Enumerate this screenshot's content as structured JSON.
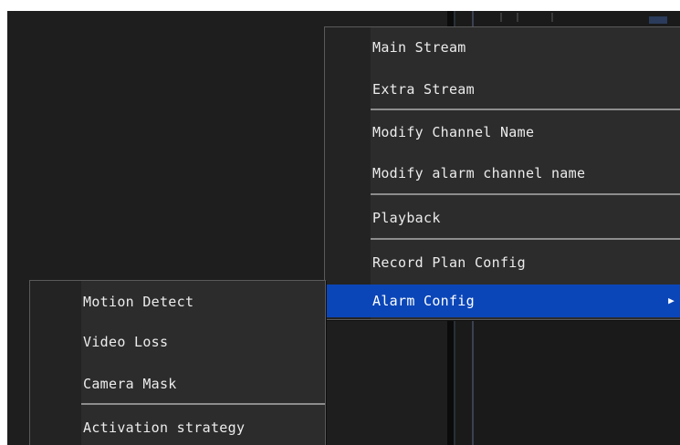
{
  "main_menu": {
    "items": [
      {
        "label": "Main Stream"
      },
      {
        "label": "Extra Stream"
      },
      {
        "label": "Modify Channel Name"
      },
      {
        "label": "Modify alarm channel name"
      },
      {
        "label": "Playback"
      },
      {
        "label": "Record Plan Config"
      },
      {
        "label": "Alarm Config",
        "highlighted": true,
        "has_submenu": true
      }
    ],
    "submenu_arrow": "▶"
  },
  "submenu": {
    "items": [
      {
        "label": "Motion Detect"
      },
      {
        "label": "Video Loss"
      },
      {
        "label": "Camera Mask"
      },
      {
        "label": "Activation strategy"
      }
    ]
  },
  "colors": {
    "menu_bg": "#2c2c2c",
    "highlight": "#0b46b8",
    "text": "#ececec"
  }
}
